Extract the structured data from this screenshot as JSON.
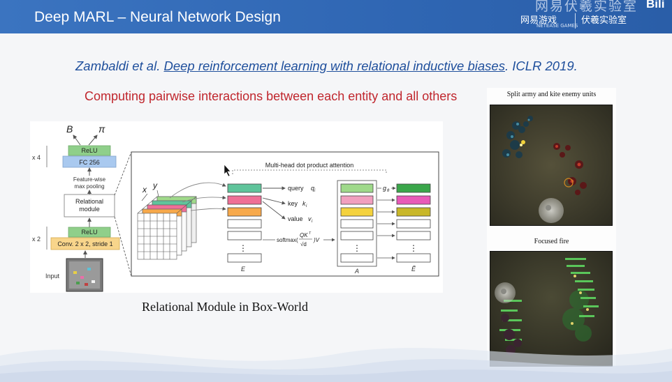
{
  "header": {
    "title": "Deep MARL – Neural Network Design",
    "logo_top": "网易伏羲实验室",
    "logo_top_b": "Bili",
    "logo_netease": "网易游戏",
    "logo_netease_sub": "NETEASE GAMES",
    "logo_fuxi": "伏羲实验室"
  },
  "citation": {
    "authors": "Zambaldi et al. ",
    "paper_title": "Deep reinforcement learning with relational inductive biases",
    "venue": ". ICLR 2019."
  },
  "subtitle": "Computing pairwise interactions between each entity and all others",
  "figure": {
    "caption": "Relational Module in Box-World",
    "labels": {
      "B": "B",
      "pi": "π",
      "x4": "x 4",
      "relu_top": "ReLU",
      "fc": "FC 256",
      "pool_1": "Feature-wise",
      "pool_2": "max pooling",
      "relational_1": "Relational",
      "relational_2": "module",
      "x2": "x 2",
      "relu_bottom": "ReLU",
      "conv": "Conv. 2 x 2, stride 1",
      "input": "Input",
      "x_axis": "x",
      "y_axis": "y",
      "attention_title": "Multi-head dot product attention",
      "query": "query",
      "query_sym": "q",
      "key": "key",
      "key_sym": "k",
      "value": "value",
      "value_sym": "v",
      "index_i": "i",
      "g_theta": "g",
      "theta": "θ",
      "softmax": "softmax(",
      "softmax_num": "QK",
      "softmax_T": "T",
      "softmax_den": "√d",
      "softmax_tail": ")V",
      "E": "E",
      "A": "A",
      "E_tilde": "Ẽ",
      "dots": "⋮"
    },
    "colors": {
      "relu": "#8fcf8a",
      "fc": "#a9c9ef",
      "conv": "#f8d58b",
      "teal": "#5fc49b",
      "pink": "#ef6f96",
      "orange": "#f7a94b",
      "lightgreen": "#9fd98a",
      "lightpink": "#f19fbf",
      "yellow": "#f4d23d",
      "green": "#3aa64a",
      "magenta": "#e85ab8",
      "olive": "#c8b728"
    }
  },
  "panel": {
    "top_label": "Split army and kite enemy units",
    "bottom_label": "Focused fire"
  }
}
